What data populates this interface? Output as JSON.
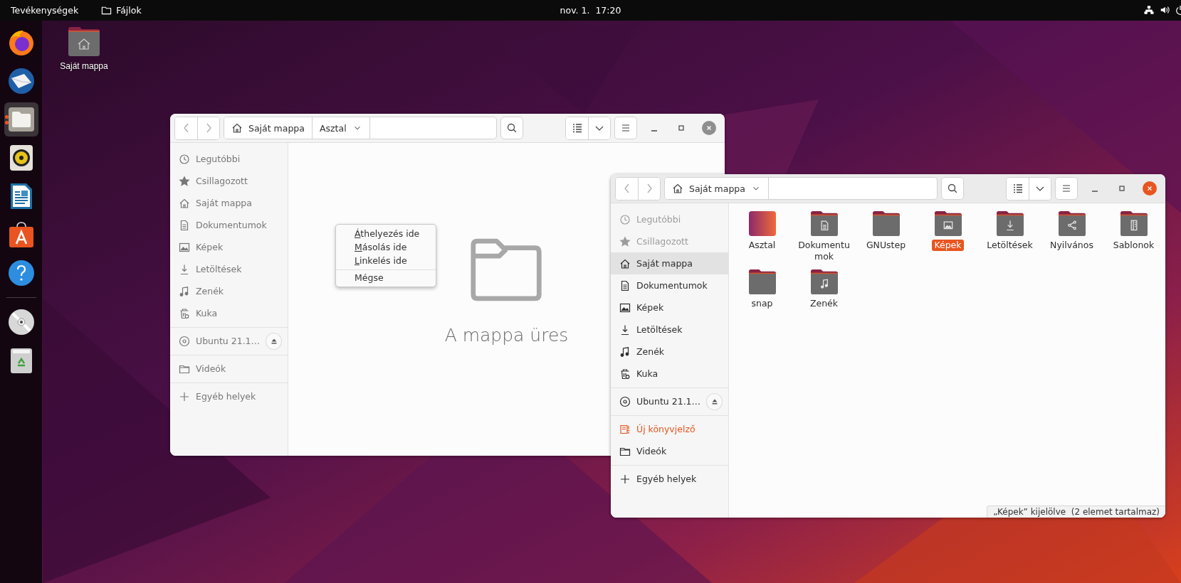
{
  "top_bar": {
    "activities": "Tevékenységek",
    "app_name": "Fájlok",
    "clock": "nov. 1.  17:20"
  },
  "dock": {
    "apps": [
      {
        "kind": "browser",
        "selected": false,
        "running": false
      },
      {
        "kind": "mail",
        "selected": false,
        "running": false
      },
      {
        "kind": "files",
        "selected": true,
        "running": true
      },
      {
        "kind": "music",
        "selected": false,
        "running": false
      },
      {
        "kind": "writer",
        "selected": false,
        "running": false
      },
      {
        "kind": "store",
        "selected": false,
        "running": false
      },
      {
        "kind": "help",
        "selected": false,
        "running": false
      }
    ],
    "devices": [
      {
        "kind": "disc"
      },
      {
        "kind": "trash"
      }
    ]
  },
  "desktop": {
    "icons": [
      {
        "label": "Saját mappa"
      }
    ]
  },
  "windows": [
    {
      "active": false,
      "path": [
        {
          "label": "Saját mappa",
          "kind": "home"
        },
        {
          "label": "Asztal",
          "kind": "folder"
        }
      ],
      "sidebar": [
        {
          "items": [
            {
              "label": "Legutóbbi",
              "kind": "recent",
              "selected": false,
              "disabled": false
            },
            {
              "label": "Csillagozott",
              "kind": "starred",
              "selected": false,
              "disabled": false
            },
            {
              "label": "Saját mappa",
              "kind": "home",
              "selected": false,
              "disabled": false
            },
            {
              "label": "Dokumentumok",
              "kind": "documents",
              "selected": false,
              "disabled": false
            },
            {
              "label": "Képek",
              "kind": "pictures",
              "selected": false,
              "disabled": false
            },
            {
              "label": "Letöltések",
              "kind": "downloads",
              "selected": false,
              "disabled": false
            },
            {
              "label": "Zenék",
              "kind": "music",
              "selected": false,
              "disabled": false
            },
            {
              "label": "Kuka",
              "kind": "trash",
              "selected": false,
              "disabled": false
            }
          ]
        },
        {
          "items": [
            {
              "label": "Ubuntu 21.1…",
              "kind": "disc",
              "selected": false,
              "disabled": false,
              "eject": true
            }
          ]
        },
        {
          "items": [
            {
              "label": "Videók",
              "kind": "folder",
              "selected": false,
              "disabled": false
            }
          ]
        },
        {
          "items": [
            {
              "label": "Egyéb helyek",
              "kind": "other",
              "selected": false,
              "disabled": false
            }
          ]
        }
      ],
      "content": {
        "kind": "empty",
        "message": "A mappa üres"
      },
      "context_menu": {
        "items": [
          {
            "label": "Áthelyezés ide",
            "mnemonic": true,
            "separator_before": false
          },
          {
            "label": "Másolás ide",
            "mnemonic": true,
            "separator_before": false
          },
          {
            "label": "Linkelés ide",
            "mnemonic": true,
            "separator_before": false
          },
          {
            "label": "Mégse",
            "mnemonic": false,
            "separator_before": true
          }
        ]
      }
    },
    {
      "active": true,
      "path": [
        {
          "label": "Saját mappa",
          "kind": "home"
        }
      ],
      "sidebar": [
        {
          "items": [
            {
              "label": "Legutóbbi",
              "kind": "recent",
              "selected": false,
              "disabled": true
            },
            {
              "label": "Csillagozott",
              "kind": "starred",
              "selected": false,
              "disabled": true
            },
            {
              "label": "Saját mappa",
              "kind": "home",
              "selected": true,
              "disabled": false
            },
            {
              "label": "Dokumentumok",
              "kind": "documents",
              "selected": false,
              "disabled": false
            },
            {
              "label": "Képek",
              "kind": "pictures",
              "selected": false,
              "disabled": false
            },
            {
              "label": "Letöltések",
              "kind": "downloads",
              "selected": false,
              "disabled": false
            },
            {
              "label": "Zenék",
              "kind": "music",
              "selected": false,
              "disabled": false
            },
            {
              "label": "Kuka",
              "kind": "trash",
              "selected": false,
              "disabled": false
            }
          ]
        },
        {
          "items": [
            {
              "label": "Ubuntu 21.1…",
              "kind": "disc",
              "selected": false,
              "disabled": false,
              "eject": true
            }
          ]
        },
        {
          "items": [
            {
              "label": "Új könyvjelző",
              "kind": "new-bookmark",
              "selected": false,
              "disabled": false
            },
            {
              "label": "Videók",
              "kind": "folder",
              "selected": false,
              "disabled": false
            }
          ]
        },
        {
          "items": [
            {
              "label": "Egyéb helyek",
              "kind": "other",
              "selected": false,
              "disabled": false
            }
          ]
        }
      ],
      "content": {
        "kind": "grid",
        "items": [
          {
            "label": "Asztal",
            "kind": "desktop",
            "selected": false
          },
          {
            "label": "Dokumentumok",
            "kind": "documents",
            "selected": false
          },
          {
            "label": "GNUstep",
            "kind": "plain",
            "selected": false
          },
          {
            "label": "Képek",
            "kind": "pictures",
            "selected": true
          },
          {
            "label": "Letöltések",
            "kind": "downloads",
            "selected": false
          },
          {
            "label": "Nyilvános",
            "kind": "public",
            "selected": false
          },
          {
            "label": "Sablonok",
            "kind": "templates",
            "selected": false
          },
          {
            "label": "snap",
            "kind": "plain",
            "selected": false
          },
          {
            "label": "Zenék",
            "kind": "music",
            "selected": false
          }
        ]
      },
      "status": "„Képek” kijelölve  (2 elemet tartalmaz)"
    }
  ]
}
